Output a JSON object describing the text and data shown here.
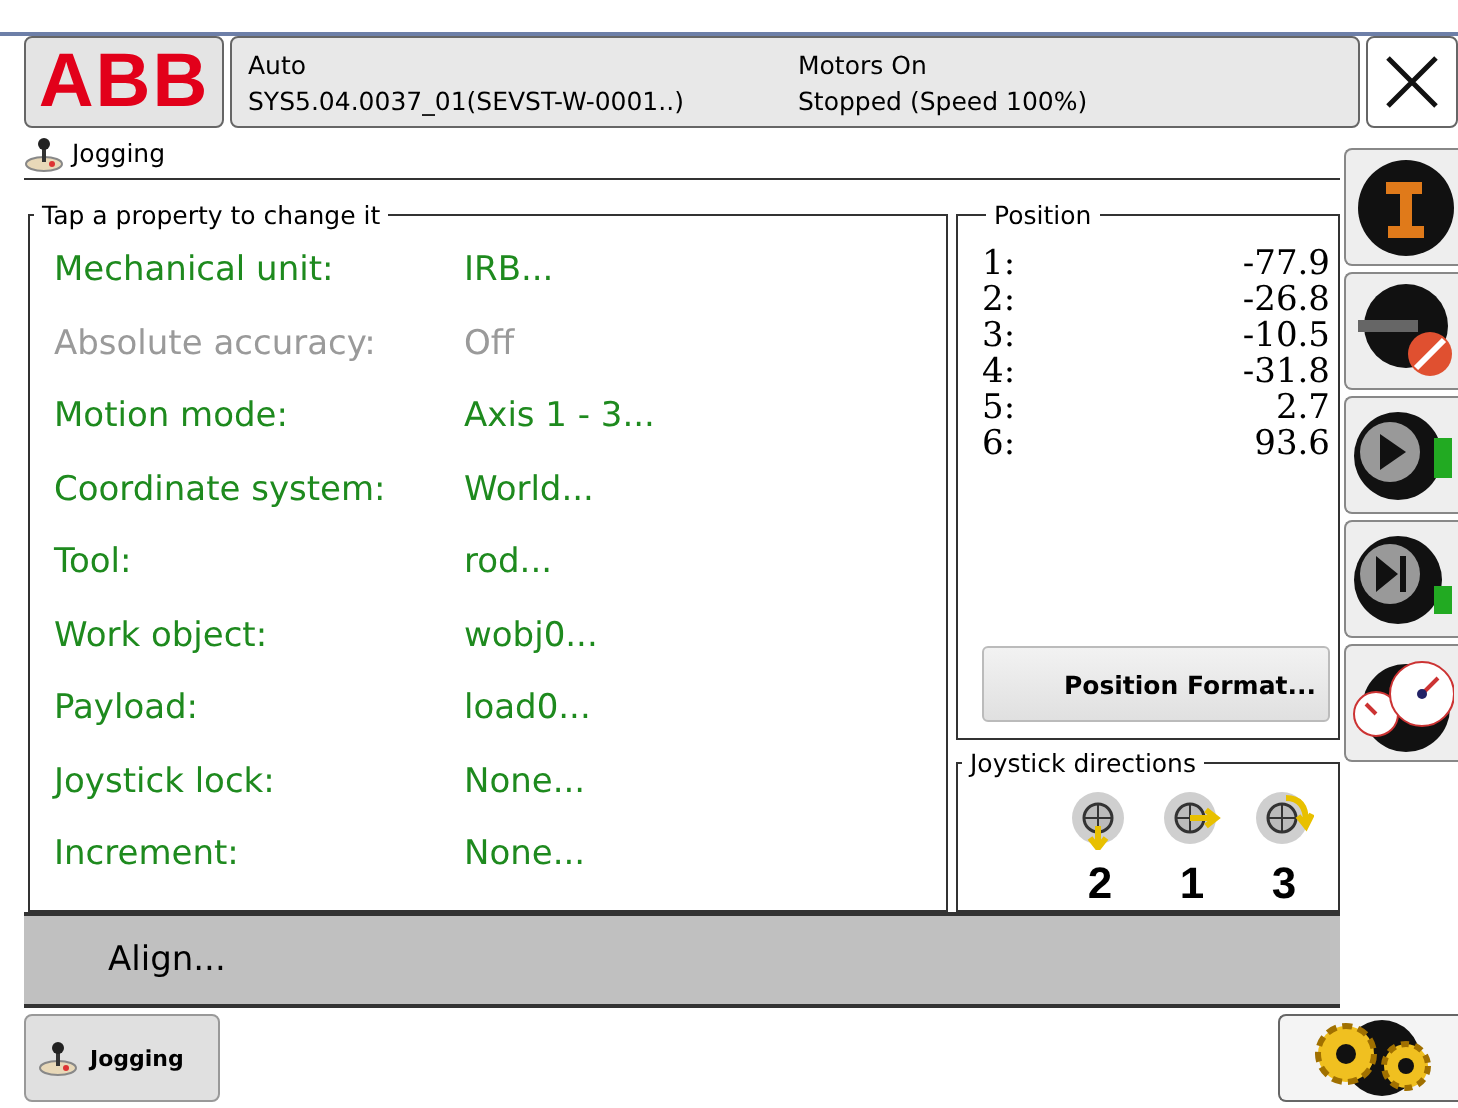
{
  "header": {
    "logo": "ABB",
    "mode": "Auto",
    "system": "SYS5.04.0037_01(SEVST-W-0001..)",
    "motors": "Motors On",
    "state": "Stopped (Speed 100%)"
  },
  "title": "Jogging",
  "properties": {
    "legend": "Tap a property to change it",
    "items": [
      {
        "label": "Mechanical unit:",
        "value": "IRB...",
        "disabled": false
      },
      {
        "label": "Absolute accuracy:",
        "value": "Off",
        "disabled": true
      },
      {
        "label": "Motion mode:",
        "value": "Axis 1 - 3...",
        "disabled": false
      },
      {
        "label": "Coordinate system:",
        "value": "World...",
        "disabled": false
      },
      {
        "label": "Tool:",
        "value": "rod...",
        "disabled": false
      },
      {
        "label": "Work object:",
        "value": "wobj0...",
        "disabled": false
      },
      {
        "label": "Payload:",
        "value": "load0...",
        "disabled": false
      },
      {
        "label": "Joystick lock:",
        "value": "None...",
        "disabled": false
      },
      {
        "label": "Increment:",
        "value": "None...",
        "disabled": false
      }
    ]
  },
  "position": {
    "legend": "Position",
    "rows": [
      {
        "axis": "1:",
        "value": "-77.9"
      },
      {
        "axis": "2:",
        "value": "-26.8"
      },
      {
        "axis": "3:",
        "value": "-10.5"
      },
      {
        "axis": "4:",
        "value": "-31.8"
      },
      {
        "axis": "5:",
        "value": "2.7"
      },
      {
        "axis": "6:",
        "value": "93.6"
      }
    ],
    "button": "Position Format..."
  },
  "joystick": {
    "legend": "Joystick directions",
    "directions": [
      {
        "kind": "down",
        "label": "2"
      },
      {
        "kind": "right",
        "label": "1"
      },
      {
        "kind": "rotate",
        "label": "3"
      }
    ]
  },
  "align_button": "Align...",
  "taskbar": [
    {
      "label": "Jogging"
    }
  ]
}
